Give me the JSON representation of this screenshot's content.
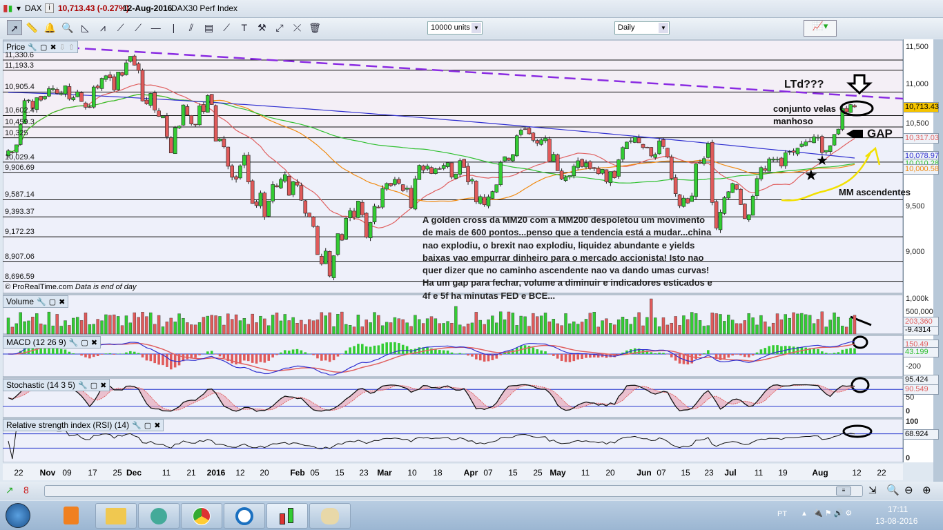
{
  "window": {
    "symbol": "DAX",
    "last": "10,713.43 (-0.27%)",
    "date": "12-Aug-2016",
    "name": "DAX30 Perf Index"
  },
  "toolbar": {
    "units": "10000 units",
    "period": "Daily",
    "icons": [
      "pointer",
      "ruler",
      "alarm-bell",
      "magnifier",
      "triangle-pattern",
      "channel",
      "segment",
      "line",
      "horizontal-line",
      "vertical-line",
      "parallel-lines",
      "fibonacci",
      "trend-channel",
      "text",
      "tools",
      "arrows",
      "cross-line",
      "trash"
    ]
  },
  "price_panel": {
    "title": "Price",
    "copyright": "© ProRealTime.com",
    "note": "Data is end of day",
    "axis": [
      "11,500",
      "11,000",
      "10,500",
      "9,500",
      "9,000"
    ],
    "last_box": "10,713.43",
    "ma_boxes": [
      {
        "v": "10,317.03",
        "c": "#e06060"
      },
      {
        "v": "10,078.97",
        "c": "#3030d0"
      },
      {
        "v": "10,010.28",
        "c": "#30c030"
      },
      {
        "v": "10,000.58",
        "c": "#f08a10"
      }
    ],
    "levels": [
      "11,330.6",
      "11,193.3",
      "10,905.4",
      "10,602.4",
      "10,459.3",
      "10,325",
      "10,029.4",
      "9,906.69",
      "9,587.14",
      "9,393.37",
      "9,172.23",
      "8,907.06",
      "8,696.59"
    ],
    "annotations": {
      "ltd": "LTd???",
      "velas1": "conjunto velas",
      "velas2": "manhoso",
      "gap": "GAP",
      "mm": "MM ascendentes",
      "comment": [
        "A golden cross da MM20 com a MM200 despoletou um movimento",
        "de mais de 600 pontos...penso que a tendencia está a mudar...china",
        "nao explodiu, o brexit nao explodiu, liquidez abundante e yields",
        "baixas vao empurrar dinheiro para o mercado accionista! Isto nao",
        "quer dizer que no caminho ascendente nao va dando umas curvas!",
        "Ha um gap para fechar, volume a diminuir e indicadores esticados e",
        "4f e 5f ha minutas FED e BCE..."
      ]
    }
  },
  "volume_panel": {
    "title": "Volume",
    "axis": [
      "1,000k",
      "500,000"
    ],
    "box1": "203,360",
    "box2": "-9.4314"
  },
  "macd_panel": {
    "title": "MACD (12 26 9)",
    "axis": [
      "-200"
    ],
    "box1": "150.49",
    "box2": "43.199"
  },
  "stoch_panel": {
    "title": "Stochastic (14 3 5)",
    "axis": [
      "50",
      "0"
    ],
    "box1": "90.549",
    "box0": "95.424"
  },
  "rsi_panel": {
    "title": "Relative strength index (RSI) (14)",
    "axis": [
      "100",
      "50",
      "0"
    ],
    "box1": "68.924"
  },
  "xaxis": [
    "22",
    "Nov",
    "09",
    "17",
    "25",
    "Dec",
    "11",
    "21",
    "2016",
    "12",
    "20",
    "Feb",
    "05",
    "15",
    "23",
    "Mar",
    "10",
    "18",
    "Apr",
    "07",
    "15",
    "25",
    "May",
    "11",
    "20",
    "Jun",
    "07",
    "15",
    "23",
    "Jul",
    "11",
    "19",
    "Aug",
    "12",
    "22"
  ],
  "taskbar": {
    "lang": "PT",
    "time": "17:11",
    "date": "13-08-2016"
  },
  "chart_data": {
    "type": "candlestick",
    "scale": "log",
    "ylim": [
      8600,
      11600
    ],
    "close": [
      10165,
      10148,
      10238,
      10492,
      10794,
      10801,
      10692,
      10832,
      10800,
      10850,
      10950,
      10951,
      10887,
      10887,
      10988,
      10815,
      10832,
      10907,
      10782,
      10708,
      10713,
      10971,
      10960,
      11085,
      11119,
      11092,
      10933,
      11170,
      11125,
      11293,
      11382,
      11261,
      11190,
      10789,
      10752,
      10887,
      10673,
      10592,
      10598,
      10340,
      10139,
      10451,
      10470,
      10738,
      10608,
      10497,
      10488,
      10727,
      10653,
      10860,
      10743,
      10283,
      10310,
      10214,
      9979,
      9849,
      9825,
      9985,
      10110,
      9794,
      9545,
      9521,
      9665,
      9392,
      9574,
      9764,
      9736,
      9823,
      9880,
      9639,
      9798,
      9757,
      9582,
      9434,
      9393,
      9286,
      8979,
      8879,
      9017,
      8752,
      8967,
      9207,
      9135,
      9377,
      9463,
      9388,
      9573,
      9416,
      9167,
      9331,
      9513,
      9495,
      9717,
      9776,
      9751,
      9824,
      9778,
      9692,
      9723,
      9498,
      9831,
      9990,
      9933,
      9983,
      9892,
      9950,
      9948,
      9990,
      10022,
      9851,
      9887,
      10047,
      9965,
      9794,
      9822,
      9563,
      9624,
      9530,
      9622,
      9682,
      9761,
      10026,
      10094,
      10051,
      10120,
      10350,
      10421,
      10435,
      10373,
      10294,
      10259,
      10299,
      10321,
      10039,
      10123,
      9926,
      9828,
      9851,
      9869,
      9980,
      10045,
      9975,
      10020,
      9952,
      9952,
      9890,
      9943,
      9795,
      9916,
      9842,
      10057,
      10205,
      10272,
      10287,
      10333,
      10263,
      10205,
      10208,
      10103,
      10121,
      10287,
      10217,
      10088,
      9834,
      9657,
      9519,
      9606,
      9550,
      9631,
      10008,
      10015,
      10071,
      10257,
      9557,
      9268,
      9447,
      9612,
      9680,
      9776,
      9709,
      9532,
      9373,
      9418,
      9629,
      9833,
      9964,
      9930,
      10068,
      10066,
      10063,
      9981,
      10142,
      10156,
      10147,
      10198,
      10247,
      10274,
      10275,
      10337,
      10330,
      10144,
      10170,
      10228,
      10367,
      10432,
      10693,
      10650,
      10743,
      10713
    ]
  }
}
